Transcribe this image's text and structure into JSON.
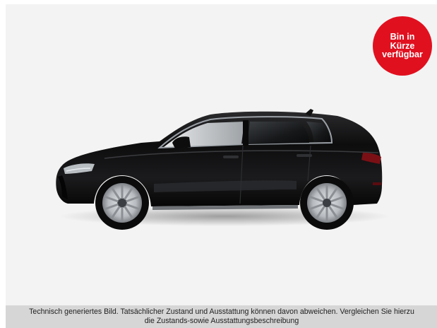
{
  "badge": {
    "line1": "Bin in",
    "line2": "Kürze",
    "line3": "verfügbar",
    "color": "#e1101f"
  },
  "disclaimer": {
    "line1": "Technisch generiertes Bild. Tatsächlicher Zustand und Ausstattung können davon abweichen. Vergleichen Sie hierzu",
    "line2": "die Zustands-sowie Ausstattungsbeschreibung"
  },
  "colors": {
    "background": "#f3f3f3",
    "car_body": "#0c0c0d",
    "disclaimer_bar": "#d6d6d6"
  }
}
